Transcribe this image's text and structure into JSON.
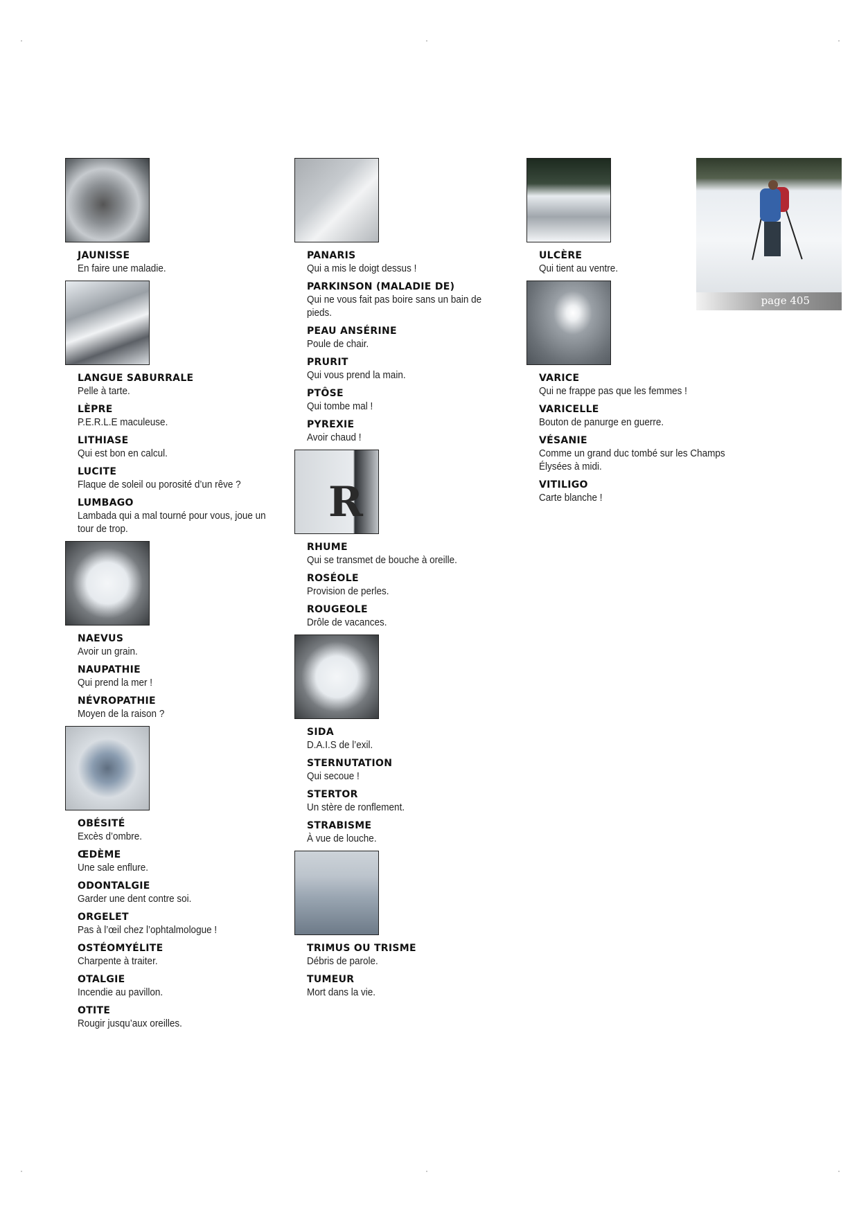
{
  "page": {
    "label": "page 405"
  },
  "col1": [
    {
      "photo": "ph1",
      "entries": [
        {
          "term": "JAUNISSE",
          "def": "En faire une maladie."
        }
      ]
    },
    {
      "photo": "ph2",
      "entries": [
        {
          "term": "LANGUE SABURRALE",
          "def": "Pelle à tarte."
        },
        {
          "term": "LÈPRE",
          "def": "P.E.R.L.E maculeuse."
        },
        {
          "term": "LITHIASE",
          "def": "Qui est bon en calcul."
        },
        {
          "term": "LUCITE",
          "def": "Flaque de soleil ou porosité d’un rêve ?"
        },
        {
          "term": "LUMBAGO",
          "def": "Lambada qui a mal tourné pour vous, joue un\ntour de trop."
        }
      ]
    },
    {
      "photo": "ph3",
      "entries": [
        {
          "term": "NAEVUS",
          "def": "Avoir un grain."
        },
        {
          "term": "NAUPATHIE",
          "def": "Qui prend la mer !"
        },
        {
          "term": "NÉVROPATHIE",
          "def": "Moyen de la raison ?"
        }
      ]
    },
    {
      "photo": "ph4",
      "entries": [
        {
          "term": "OBÉSITÉ",
          "def": "Excès d’ombre."
        },
        {
          "term": "ŒDÈME",
          "def": "Une sale enflure."
        },
        {
          "term": "ODONTALGIE",
          "def": "Garder une dent contre soi."
        },
        {
          "term": "ORGELET",
          "def": "Pas à l’œil chez l’ophtalmologue !"
        },
        {
          "term": "OSTÉOMYÉLITE",
          "def": "Charpente à traiter."
        },
        {
          "term": "OTALGIE",
          "def": "Incendie au pavillon."
        },
        {
          "term": "OTITE",
          "def": "Rougir jusqu’aux oreilles."
        }
      ]
    }
  ],
  "col2": [
    {
      "photo": "ph5",
      "entries": [
        {
          "term": "PANARIS",
          "def": "Qui a mis le doigt dessus !"
        },
        {
          "term": "PARKINSON (MALADIE DE)",
          "def": "Qui ne vous fait pas boire sans un bain de\npieds."
        },
        {
          "term": "PEAU ANSÉRINE",
          "def": "Poule de chair."
        },
        {
          "term": "PRURIT",
          "def": "Qui vous prend la main."
        },
        {
          "term": "PTÔSE",
          "def": "Qui tombe mal !"
        },
        {
          "term": "PYREXIE",
          "def": "Avoir chaud !"
        }
      ]
    },
    {
      "photo": "ph6",
      "letter": "R",
      "entries": [
        {
          "term": "RHUME",
          "def": "Qui se transmet de bouche à oreille."
        },
        {
          "term": "ROSÉOLE",
          "def": "Provision de perles."
        },
        {
          "term": "ROUGEOLE",
          "def": "Drôle de vacances."
        }
      ]
    },
    {
      "photo": "ph3",
      "entries": [
        {
          "term": "SIDA",
          "def": "D.A.I.S de l’exil."
        },
        {
          "term": "STERNUTATION",
          "def": "Qui secoue !"
        },
        {
          "term": "STERTOR",
          "def": "Un stère de ronflement."
        },
        {
          "term": "STRABISME",
          "def": "À vue de louche."
        }
      ]
    },
    {
      "photo": "ph7",
      "entries": [
        {
          "term": "TRIMUS OU TRISME",
          "def": "Débris de parole."
        },
        {
          "term": "TUMEUR",
          "def": "Mort dans la vie."
        }
      ]
    }
  ],
  "col3": [
    {
      "photo": "ph8",
      "entries": [
        {
          "term": "ULCÈRE",
          "def": "Qui tient au ventre."
        }
      ]
    },
    {
      "photo": "ph9",
      "entries": [
        {
          "term": "VARICE",
          "def": "Qui ne frappe pas que les femmes !"
        },
        {
          "term": "VARICELLE",
          "def": "Bouton de panurge en guerre."
        },
        {
          "term": "VÉSANIE",
          "def": "Comme un grand duc tombé sur les Champs\nÉlysées à midi."
        },
        {
          "term": "VITILIGO",
          "def": "Carte blanche !"
        }
      ]
    }
  ]
}
